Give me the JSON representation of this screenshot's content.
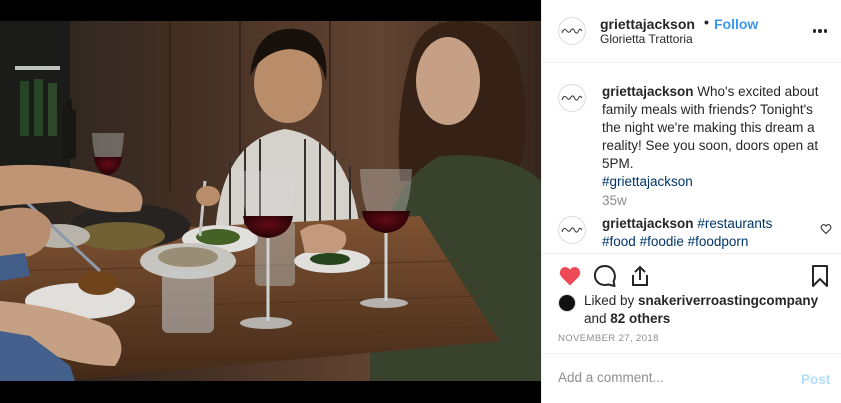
{
  "post": {
    "image_alt": "Friends sharing a meal with red wine at a wooden table",
    "header": {
      "username": "griettajackson",
      "separator": "•",
      "follow_label": "Follow",
      "location": "Glorietta Trattoria",
      "more_icon": "more-horizontal-icon"
    },
    "caption": {
      "username": "griettajackson",
      "text": " Who's excited about family meals with friends? Tonight's the night we're making this dream a reality! See you soon, doors open at 5PM.",
      "hashtag": "#griettajackson",
      "age": "35w"
    },
    "comment": {
      "username": "griettajackson",
      "tags": [
        "#restaurants",
        "#food",
        "#foodie",
        "#foodporn"
      ]
    },
    "actions": {
      "like_icon": "heart-filled-icon",
      "comment_icon": "comment-icon",
      "share_icon": "share-icon",
      "save_icon": "bookmark-icon",
      "like_color": "#ed4956"
    },
    "likes": {
      "prefix": "Liked by ",
      "user": "snakeriverroastingcompany",
      "and": "and ",
      "others": "82 others"
    },
    "date": "NOVEMBER 27, 2018",
    "add_comment": {
      "placeholder": "Add a comment...",
      "post_label": "Post"
    }
  },
  "colors": {
    "link_blue": "#3897f0",
    "hashtag": "#003569",
    "muted": "#8e8e8e",
    "post_disabled": "#b2dffc"
  }
}
